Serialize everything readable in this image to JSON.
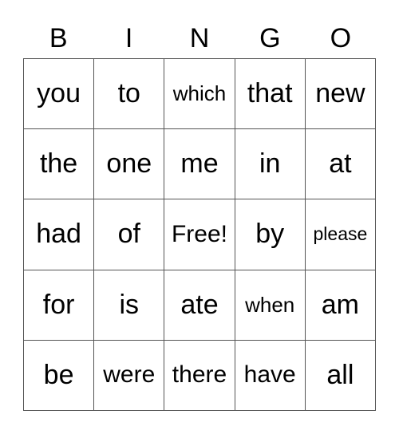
{
  "header": [
    "B",
    "I",
    "N",
    "G",
    "O"
  ],
  "cells": [
    [
      "you",
      "to",
      "which",
      "that",
      "new"
    ],
    [
      "the",
      "one",
      "me",
      "in",
      "at"
    ],
    [
      "had",
      "of",
      "Free!",
      "by",
      "please"
    ],
    [
      "for",
      "is",
      "ate",
      "when",
      "am"
    ],
    [
      "be",
      "were",
      "there",
      "have",
      "all"
    ]
  ]
}
